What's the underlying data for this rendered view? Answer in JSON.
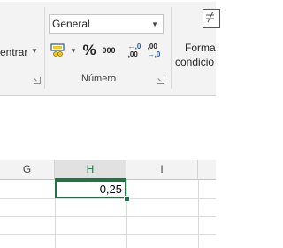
{
  "ribbon": {
    "alignment": {
      "merge_label": "entrar"
    },
    "number": {
      "format_value": "General",
      "group_label": "Número",
      "percent_symbol": "%",
      "thousands_symbol": "000",
      "increase_decimal_top": "←,0",
      "increase_decimal_bottom": ",00",
      "decrease_decimal_top": ",00",
      "decrease_decimal_bottom": "→,0"
    },
    "styles": {
      "conditional_line1": "Forma",
      "conditional_line2": "condicio"
    }
  },
  "sheet": {
    "columns": [
      "G",
      "H",
      "I"
    ],
    "selected_column": "H",
    "active_cell": {
      "value": "0,25"
    }
  }
}
